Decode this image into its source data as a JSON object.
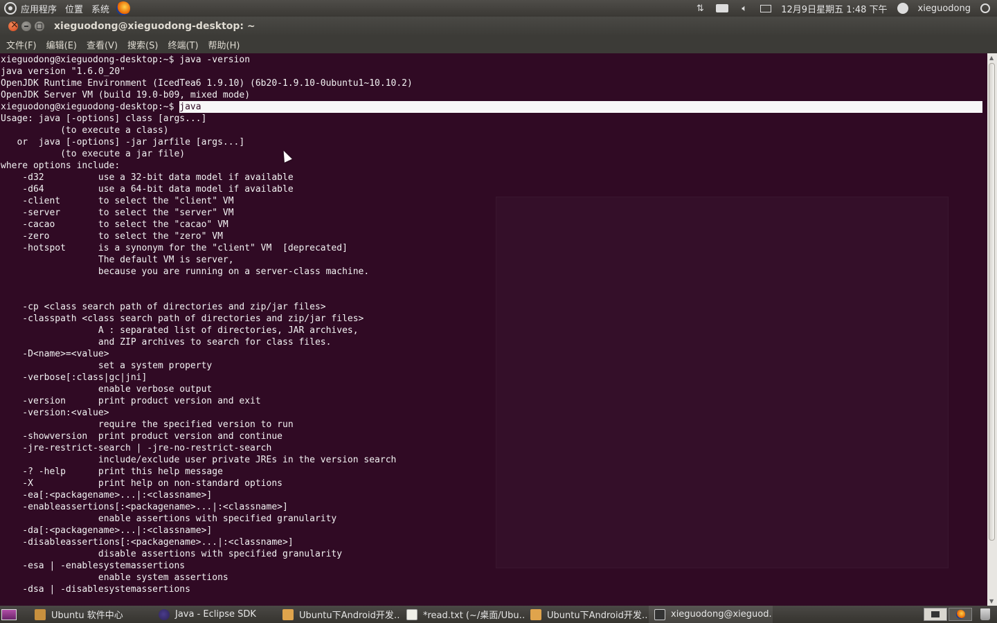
{
  "top_panel": {
    "menu_apps": "应用程序",
    "menu_places": "位置",
    "menu_system": "系统",
    "clock": "12月9日星期五  1:48 下午",
    "username": "xieguodong"
  },
  "window": {
    "title": "xieguodong@xieguodong-desktop: ~",
    "menus": [
      "文件(F)",
      "编辑(E)",
      "查看(V)",
      "搜索(S)",
      "终端(T)",
      "帮助(H)"
    ]
  },
  "terminal": {
    "block1": "xieguodong@xieguodong-desktop:~$ java -version\njava version \"1.6.0_20\"\nOpenJDK Runtime Environment (IcedTea6 1.9.10) (6b20-1.9.10-0ubuntu1~10.10.2)\nOpenJDK Server VM (build 19.0-b09, mixed mode)",
    "prompt": "xieguodong@xieguodong-desktop:~$ ",
    "highlighted_command": "java",
    "block2": "Usage: java [-options] class [args...]\n           (to execute a class)\n   or  java [-options] -jar jarfile [args...]\n           (to execute a jar file)\nwhere options include:\n    -d32          use a 32-bit data model if available\n    -d64          use a 64-bit data model if available\n    -client       to select the \"client\" VM\n    -server       to select the \"server\" VM\n    -cacao        to select the \"cacao\" VM\n    -zero         to select the \"zero\" VM\n    -hotspot      is a synonym for the \"client\" VM  [deprecated]\n                  The default VM is server,\n                  because you are running on a server-class machine.\n\n\n    -cp <class search path of directories and zip/jar files>\n    -classpath <class search path of directories and zip/jar files>\n                  A : separated list of directories, JAR archives,\n                  and ZIP archives to search for class files.\n    -D<name>=<value>\n                  set a system property\n    -verbose[:class|gc|jni]\n                  enable verbose output\n    -version      print product version and exit\n    -version:<value>\n                  require the specified version to run\n    -showversion  print product version and continue\n    -jre-restrict-search | -jre-no-restrict-search\n                  include/exclude user private JREs in the version search\n    -? -help      print this help message\n    -X            print help on non-standard options\n    -ea[:<packagename>...|:<classname>]\n    -enableassertions[:<packagename>...|:<classname>]\n                  enable assertions with specified granularity\n    -da[:<packagename>...|:<classname>]\n    -disableassertions[:<packagename>...|:<classname>]\n                  disable assertions with specified granularity\n    -esa | -enablesystemassertions\n                  enable system assertions\n    -dsa | -disablesystemassertions"
  },
  "taskbar": {
    "tasks": [
      {
        "label": "Ubuntu 软件中心"
      },
      {
        "label": "Java - Eclipse SDK"
      },
      {
        "label": "Ubuntu下Android开发…"
      },
      {
        "label": "*read.txt (~/桌面/Ubu…"
      },
      {
        "label": "Ubuntu下Android开发…"
      },
      {
        "label": "xieguodong@xieguod..."
      }
    ]
  },
  "colors": {
    "terminal_bg": "#300a24",
    "terminal_fg": "#f2f2f2",
    "panel_bg": "#3c3b37",
    "close_button": "#e0531f"
  },
  "icons": [
    "ubuntu-logo-icon",
    "firefox-icon",
    "network-icon",
    "keyboard-icon",
    "volume-icon",
    "mail-icon",
    "user-icon",
    "power-icon",
    "trash-icon"
  ]
}
